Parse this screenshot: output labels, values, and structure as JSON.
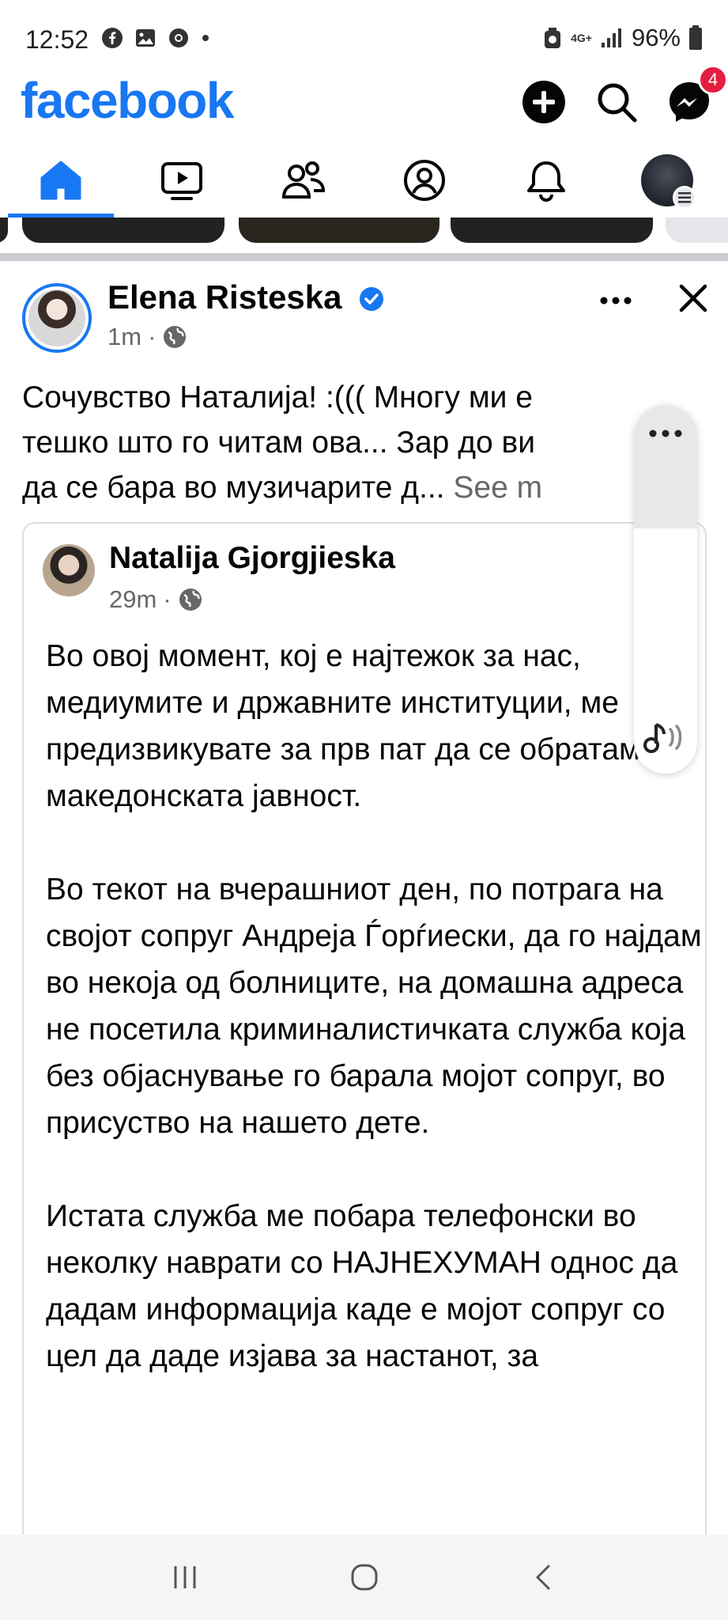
{
  "status_bar": {
    "time": "12:52",
    "battery_pct": "96%",
    "network": "4G+"
  },
  "header": {
    "logo_text": "facebook",
    "messenger_badge": "4",
    "accent_color": "#1877f2",
    "badge_color": "#e41e3f"
  },
  "nav": {
    "tabs": [
      {
        "icon": "home-icon",
        "active": true
      },
      {
        "icon": "video-icon",
        "active": false
      },
      {
        "icon": "friends-icon",
        "active": false
      },
      {
        "icon": "profile-icon",
        "active": false
      },
      {
        "icon": "bell-icon",
        "active": false
      },
      {
        "icon": "menu-avatar",
        "active": false
      }
    ]
  },
  "post": {
    "author": "Elena Risteska",
    "time": "1m",
    "text_lines": [
      "Сочувство Наталија! :((( Многу ми е",
      "тешко што го читам ова... Зар до ви",
      "да се бара во музичарите д..."
    ],
    "see_more": "See m"
  },
  "shared_post": {
    "author": "Natalija Gjorgjieska",
    "time": "29m",
    "paragraphs": [
      "Во овој момент, кој е најтежок за нас, медиумите и државните институции, ме предизвикувате за прв пат да се обратам до македонската јавност.",
      "Во текот на вчерашниот ден, по потрага на својот сопруг Андреја Ѓорѓиески, да го најдам во некоја од болниците, на домашна адреса не посетила криминалистичката служба која без објаснување го барала мојот сопруг, во присуство на нашето дете.",
      "Истата служба ме побара телефонски во неколку наврати со НАЈНЕХУМАН однос да дадам информација каде е мојот сопруг со цел да даде изјава за настанот, за"
    ]
  }
}
